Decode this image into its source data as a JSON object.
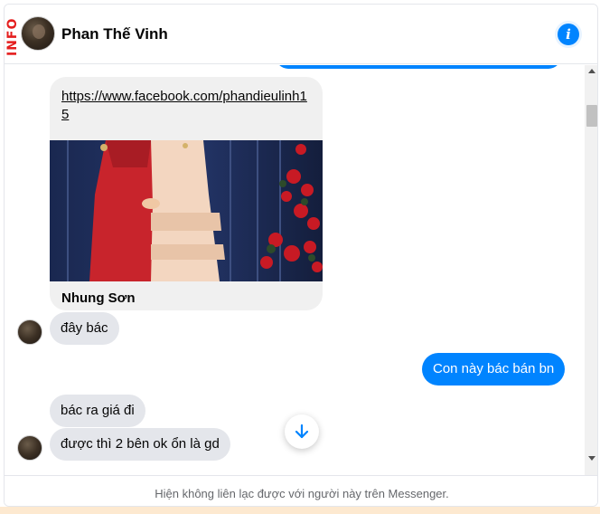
{
  "brand_tag": "INFO",
  "header": {
    "contact_name": "Phan Thế Vinh",
    "info_icon": "info-icon",
    "info_symbol": "i"
  },
  "messages": {
    "link_card": {
      "url": "https://www.facebook.com/phandieulinh15",
      "title": "Nhung Sơn"
    },
    "incoming_1": "đây bác",
    "outgoing_1": "Con này bác bán bn",
    "incoming_2": "bác ra giá đi",
    "incoming_3": "được thì 2 bên ok ổn là gd"
  },
  "footer": {
    "notice": "Hiện không liên lạc được với người này trên Messenger."
  },
  "icons": {
    "scroll_down": "arrow-down-icon",
    "scroll_up": "scroll-up-arrow",
    "scroll_bottom": "scroll-down-arrow"
  },
  "colors": {
    "accent": "#0084ff",
    "incoming_bubble": "#e4e6eb",
    "footer_text": "#65676b"
  }
}
